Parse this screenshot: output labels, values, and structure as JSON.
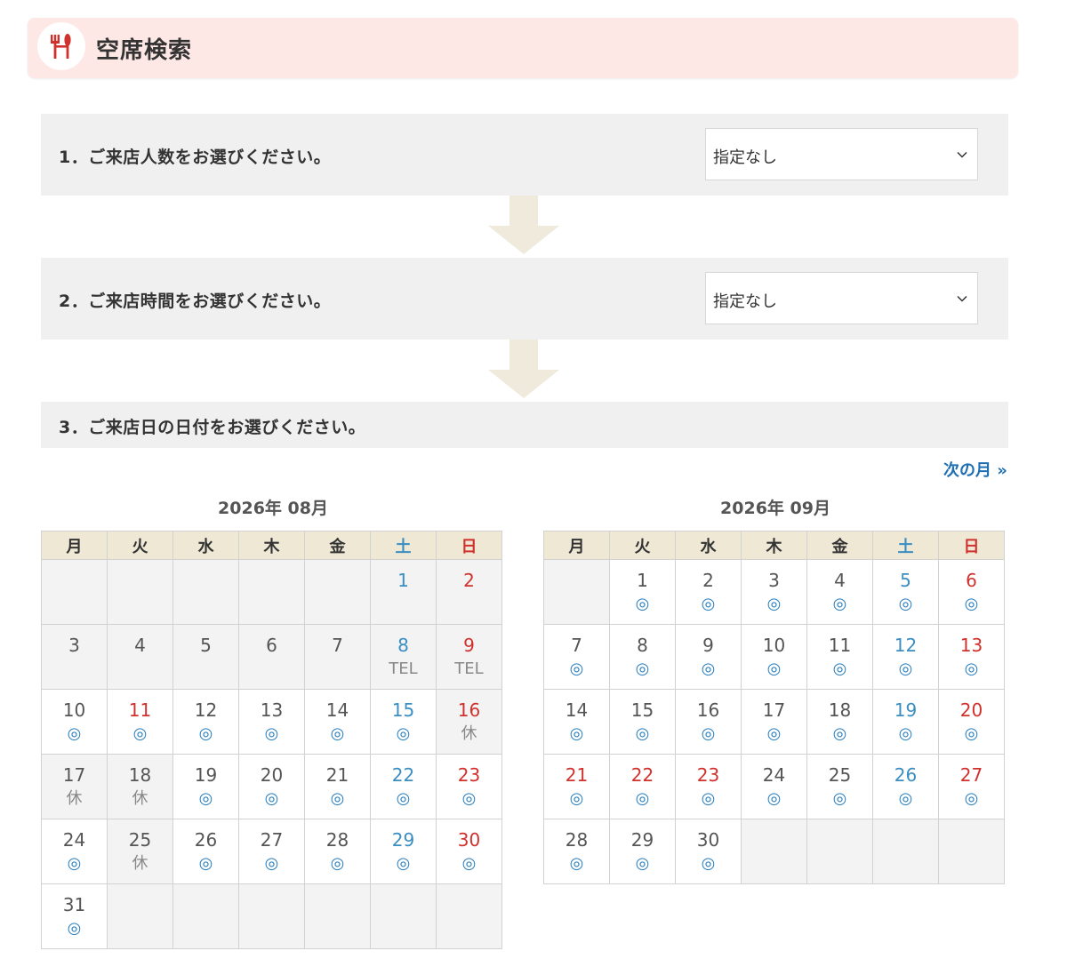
{
  "header": {
    "title": "空席検索"
  },
  "steps": [
    {
      "label": "1．ご来店人数をお選びください。",
      "select_value": "指定なし"
    },
    {
      "label": "2．ご来店時間をお選びください。",
      "select_value": "指定なし"
    },
    {
      "label": "3．ご来店日の日付をお選びください。"
    }
  ],
  "next_month": "次の月 »",
  "weekdays": [
    "月",
    "火",
    "水",
    "木",
    "金",
    "土",
    "日"
  ],
  "calendars": [
    {
      "title": "2026年 08月",
      "weeks": [
        [
          null,
          null,
          null,
          null,
          null,
          {
            "d": "1",
            "s": ""
          },
          {
            "d": "2",
            "s": ""
          }
        ],
        [
          {
            "d": "3",
            "s": ""
          },
          {
            "d": "4",
            "s": ""
          },
          {
            "d": "5",
            "s": ""
          },
          {
            "d": "6",
            "s": ""
          },
          {
            "d": "7",
            "s": ""
          },
          {
            "d": "8",
            "s": "TEL"
          },
          {
            "d": "9",
            "s": "TEL"
          }
        ],
        [
          {
            "d": "10",
            "s": "◎"
          },
          {
            "d": "11",
            "s": "◎",
            "holiday": true
          },
          {
            "d": "12",
            "s": "◎"
          },
          {
            "d": "13",
            "s": "◎"
          },
          {
            "d": "14",
            "s": "◎"
          },
          {
            "d": "15",
            "s": "◎"
          },
          {
            "d": "16",
            "s": "休"
          }
        ],
        [
          {
            "d": "17",
            "s": "休"
          },
          {
            "d": "18",
            "s": "休"
          },
          {
            "d": "19",
            "s": "◎"
          },
          {
            "d": "20",
            "s": "◎"
          },
          {
            "d": "21",
            "s": "◎"
          },
          {
            "d": "22",
            "s": "◎"
          },
          {
            "d": "23",
            "s": "◎"
          }
        ],
        [
          {
            "d": "24",
            "s": "◎"
          },
          {
            "d": "25",
            "s": "休"
          },
          {
            "d": "26",
            "s": "◎"
          },
          {
            "d": "27",
            "s": "◎"
          },
          {
            "d": "28",
            "s": "◎"
          },
          {
            "d": "29",
            "s": "◎"
          },
          {
            "d": "30",
            "s": "◎"
          }
        ],
        [
          {
            "d": "31",
            "s": "◎"
          },
          null,
          null,
          null,
          null,
          null,
          null
        ]
      ]
    },
    {
      "title": "2026年 09月",
      "weeks": [
        [
          null,
          {
            "d": "1",
            "s": "◎"
          },
          {
            "d": "2",
            "s": "◎"
          },
          {
            "d": "3",
            "s": "◎"
          },
          {
            "d": "4",
            "s": "◎"
          },
          {
            "d": "5",
            "s": "◎"
          },
          {
            "d": "6",
            "s": "◎"
          }
        ],
        [
          {
            "d": "7",
            "s": "◎"
          },
          {
            "d": "8",
            "s": "◎"
          },
          {
            "d": "9",
            "s": "◎"
          },
          {
            "d": "10",
            "s": "◎"
          },
          {
            "d": "11",
            "s": "◎"
          },
          {
            "d": "12",
            "s": "◎"
          },
          {
            "d": "13",
            "s": "◎"
          }
        ],
        [
          {
            "d": "14",
            "s": "◎"
          },
          {
            "d": "15",
            "s": "◎"
          },
          {
            "d": "16",
            "s": "◎"
          },
          {
            "d": "17",
            "s": "◎"
          },
          {
            "d": "18",
            "s": "◎"
          },
          {
            "d": "19",
            "s": "◎"
          },
          {
            "d": "20",
            "s": "◎"
          }
        ],
        [
          {
            "d": "21",
            "s": "◎",
            "holiday": true
          },
          {
            "d": "22",
            "s": "◎",
            "holiday": true
          },
          {
            "d": "23",
            "s": "◎",
            "holiday": true
          },
          {
            "d": "24",
            "s": "◎"
          },
          {
            "d": "25",
            "s": "◎"
          },
          {
            "d": "26",
            "s": "◎"
          },
          {
            "d": "27",
            "s": "◎"
          }
        ],
        [
          {
            "d": "28",
            "s": "◎"
          },
          {
            "d": "29",
            "s": "◎"
          },
          {
            "d": "30",
            "s": "◎"
          },
          null,
          null,
          null,
          null
        ]
      ]
    }
  ],
  "icons": {
    "header": "restaurant-icon",
    "select": "chevron-down-icon",
    "flow": "arrow-down-icon"
  },
  "colors": {
    "header_bg": "#fde8e5",
    "accent_red": "#d0312d",
    "saturday_blue": "#3b8ec2",
    "link_blue": "#1f6fb2",
    "weekday_header_bg": "#eee8d5",
    "arrow": "#efeadb"
  }
}
